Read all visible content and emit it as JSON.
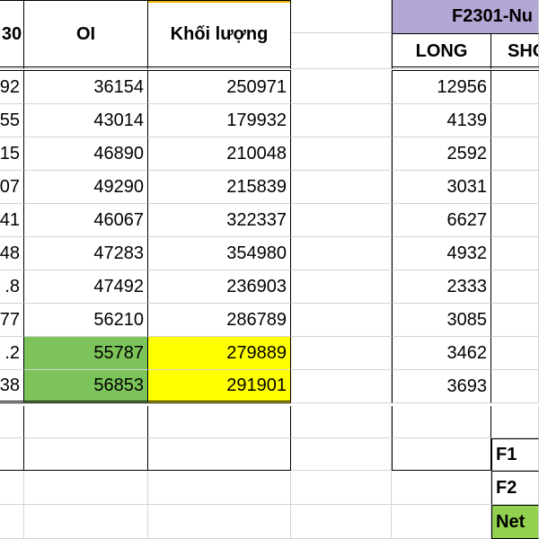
{
  "headers": {
    "col_a": "30",
    "col_oi": "OI",
    "col_volume": "Khối lượng",
    "group_title": "F2301-Nu",
    "col_long": "LONG",
    "col_short": "SHO"
  },
  "rows": [
    {
      "a": "92",
      "oi": "36154",
      "vol": "250971",
      "long": "12956"
    },
    {
      "a": "55",
      "oi": "43014",
      "vol": "179932",
      "long": "4139"
    },
    {
      "a": "15",
      "oi": "46890",
      "vol": "210048",
      "long": "2592"
    },
    {
      "a": "07",
      "oi": "49290",
      "vol": "215839",
      "long": "3031"
    },
    {
      "a": "41",
      "oi": "46067",
      "vol": "322337",
      "long": "6627"
    },
    {
      "a": "48",
      "oi": "47283",
      "vol": "354980",
      "long": "4932"
    },
    {
      "a": ".8",
      "oi": "47492",
      "vol": "236903",
      "long": "2333"
    },
    {
      "a": "77",
      "oi": "56210",
      "vol": "286789",
      "long": "3085"
    },
    {
      "a": ".2",
      "oi": "55787",
      "vol": "279889",
      "long": "3462"
    },
    {
      "a": "38",
      "oi": "56853",
      "vol": "291901",
      "long": "3693"
    }
  ],
  "summary": {
    "f1": "F1",
    "f2": "F2",
    "net": "Net"
  },
  "colors": {
    "green": "#7cc45a",
    "yellow": "#ffff00",
    "purple": "#b4a7d6",
    "net_green": "#92d050"
  }
}
